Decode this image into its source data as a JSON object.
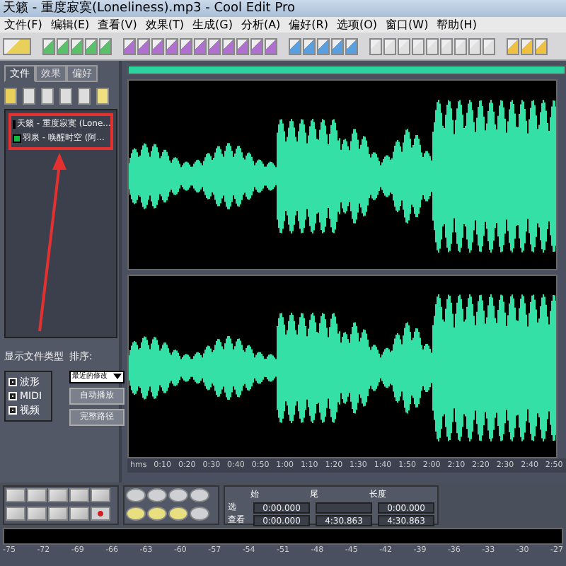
{
  "window": {
    "title": "天籁 - 重度寂寞(Loneliness).mp3 - Cool Edit Pro"
  },
  "menu": [
    "文件(F)",
    "编辑(E)",
    "查看(V)",
    "效果(T)",
    "生成(G)",
    "分析(A)",
    "偏好(R)",
    "选项(O)",
    "窗口(W)",
    "帮助(H)"
  ],
  "organizer": {
    "tabs": [
      {
        "label": "文件",
        "selected": true
      },
      {
        "label": "效果",
        "selected": false
      },
      {
        "label": "偏好",
        "selected": false
      }
    ],
    "files": [
      "天籁 - 重度寂寞 (Lone...",
      "羽泉 - 唤醒时空 (阿..."
    ],
    "file_types_label": "显示文件类型",
    "file_types": [
      {
        "label": "波形",
        "checked": true
      },
      {
        "label": "MIDI",
        "checked": true
      },
      {
        "label": "视频",
        "checked": true
      }
    ],
    "sort_label": "排序:",
    "sort_value": "最近的修改",
    "buttons": [
      "自动播放",
      "完整路径"
    ]
  },
  "ruler": [
    "hms",
    "0:10",
    "0:20",
    "0:30",
    "0:40",
    "0:50",
    "1:00",
    "1:10",
    "1:20",
    "1:30",
    "1:40",
    "1:50",
    "2:00",
    "2:10",
    "2:20",
    "2:30",
    "2:40",
    "2:50"
  ],
  "time": {
    "columns": [
      "始",
      "尾",
      "长度"
    ],
    "rows": [
      {
        "label": "选",
        "start": "0:00.000",
        "length": "0:00.000"
      },
      {
        "label": "查看",
        "start": "0:00.000",
        "end": "4:30.863",
        "length": "4:30.863"
      }
    ]
  },
  "meter": [
    "-75",
    "-72",
    "-69",
    "-66",
    "-63",
    "-60",
    "-57",
    "-54",
    "-51",
    "-48",
    "-45",
    "-42",
    "-39",
    "-36",
    "-33",
    "-30",
    "-27"
  ]
}
